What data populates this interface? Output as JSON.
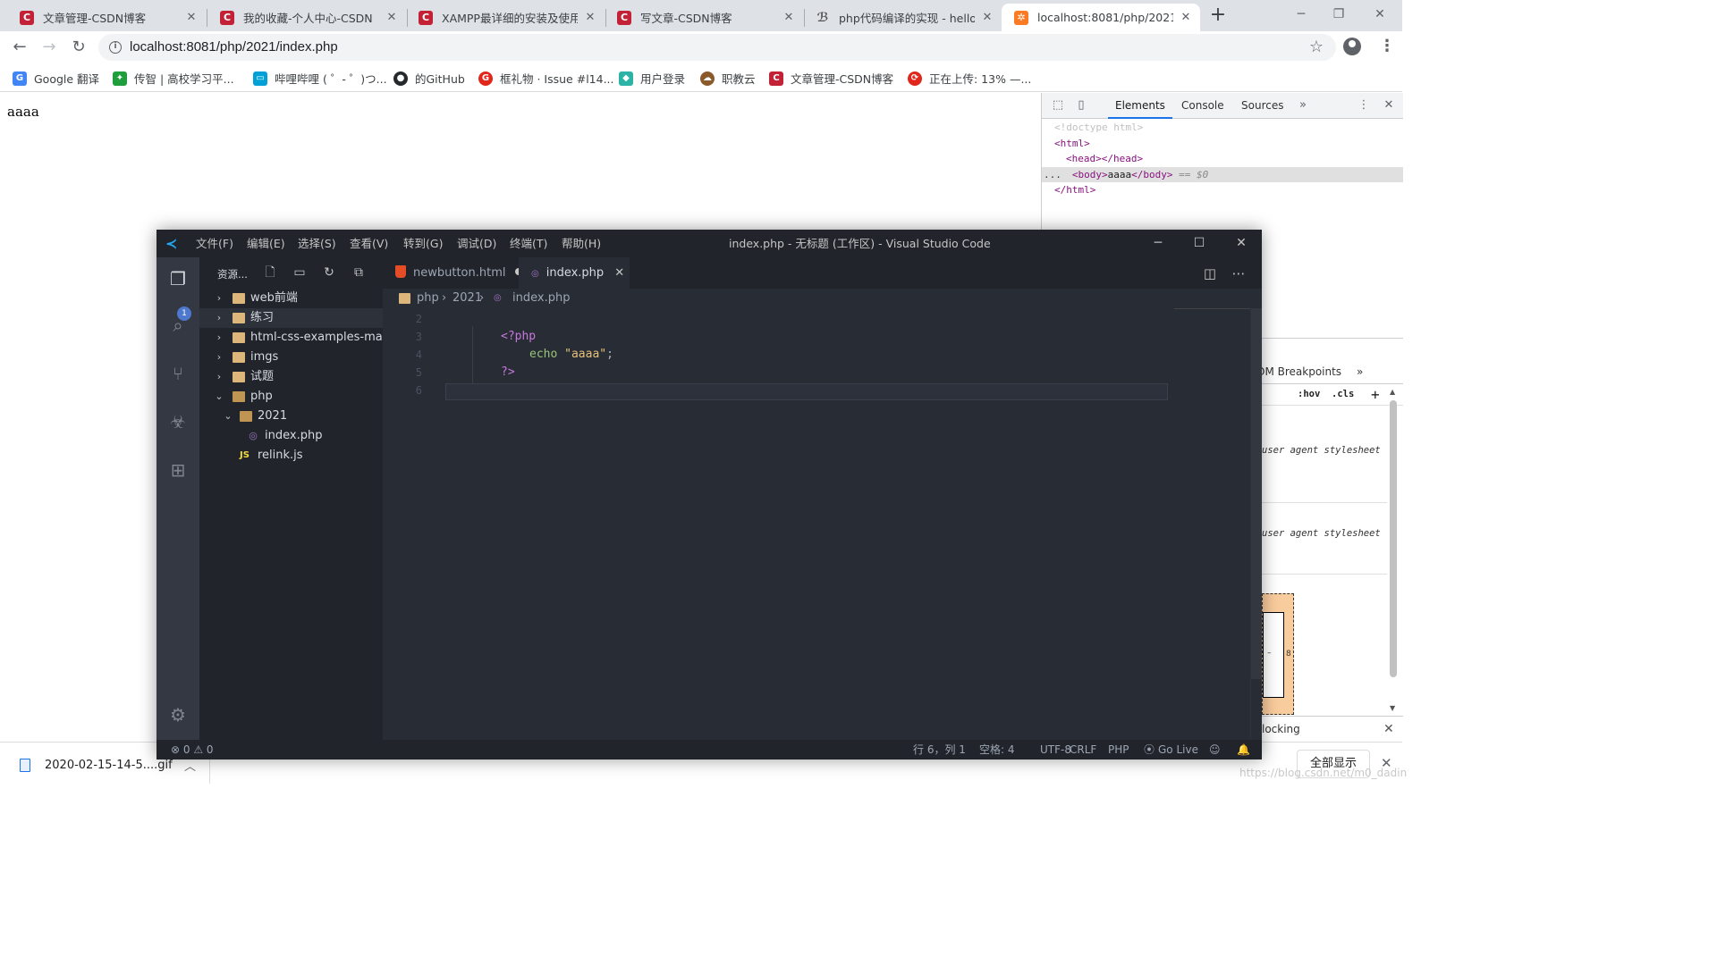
{
  "browser": {
    "tabs": [
      {
        "title": "文章管理-CSDN博客",
        "favicon_color": "#c32136"
      },
      {
        "title": "我的收藏-个人中心-CSDN",
        "favicon_color": "#c32136"
      },
      {
        "title": "XAMPP最详细的安装及使用",
        "favicon_color": "#c32136"
      },
      {
        "title": "写文章-CSDN博客",
        "favicon_color": "#c32136"
      },
      {
        "title": "php代码编译的实现 - hello",
        "favicon_color": "#555555"
      },
      {
        "title": "localhost:8081/php/2021/i",
        "favicon_color": "#fb7a24"
      }
    ],
    "new_tab_label": "+",
    "url": "localhost:8081/php/2021/index.php",
    "bookmarks": [
      {
        "label": "Google 翻译",
        "color": "#4285f4"
      },
      {
        "label": "传智 | 高校学习平...",
        "color": "#1e9e3c"
      },
      {
        "label": "哔哩哔哩 ( ゜- ゜)つ...",
        "color": "#00a1d6"
      },
      {
        "label": "的GitHub",
        "color": "#24292e"
      },
      {
        "label": "框礼物 · Issue #l14...",
        "color": "#e1261c"
      },
      {
        "label": "用户登录",
        "color": "#2bb3a5"
      },
      {
        "label": "职教云",
        "color": "#8b5a2b"
      },
      {
        "label": "文章管理-CSDN博客",
        "color": "#c32136"
      },
      {
        "label": "正在上传: 13% —...",
        "color": "#e1261c"
      }
    ]
  },
  "page": {
    "body_text": "aaaa"
  },
  "devtools": {
    "tabs": [
      "Elements",
      "Console",
      "Sources"
    ],
    "dom": {
      "doctype": "<!doctype html>",
      "html_open": "<html>",
      "head": "<head></head>",
      "body_open": "<body>",
      "body_text": "aaaa",
      "body_close": "</body>",
      "dollar": "== $0",
      "html_close": "</html>",
      "ellipsis": "..."
    },
    "lower_tab": "OM Breakpoints",
    "filter": {
      "hov": ":hov",
      "cls": ".cls"
    },
    "ua_label_1": "user agent stylesheet",
    "ua_label_2": "user agent stylesheet",
    "box_value": "8",
    "box_dash": "–",
    "blocking_label": "locking"
  },
  "downloads": {
    "file_name": "2020-02-15-14-5....gif",
    "show_all": "全部显示"
  },
  "watermark": "https://blog.csdn.net/m0_dadin",
  "vscode": {
    "menu": [
      "文件(F)",
      "编辑(E)",
      "选择(S)",
      "查看(V)",
      "转到(G)",
      "调试(D)",
      "终端(T)",
      "帮助(H)"
    ],
    "window_title": "index.php - 无标题 (工作区) - Visual Studio Code",
    "explorer_title": "资源...",
    "explorer_badge": "1",
    "tree": [
      {
        "label": "web前端",
        "depth": 0,
        "type": "folder",
        "open": false
      },
      {
        "label": "练习",
        "depth": 0,
        "type": "folder",
        "open": false
      },
      {
        "label": "html-css-examples-ma...",
        "depth": 0,
        "type": "folder",
        "open": false
      },
      {
        "label": "imgs",
        "depth": 0,
        "type": "folder",
        "open": false
      },
      {
        "label": "试题",
        "depth": 0,
        "type": "folder",
        "open": false
      },
      {
        "label": "php",
        "depth": 0,
        "type": "folder",
        "open": true
      },
      {
        "label": "2021",
        "depth": 1,
        "type": "folder",
        "open": true
      },
      {
        "label": "index.php",
        "depth": 2,
        "type": "php"
      },
      {
        "label": "relink.js",
        "depth": 1,
        "type": "js"
      }
    ],
    "js_badge": "JS",
    "editor_tabs": [
      {
        "label": "newbutton.html",
        "dirty": true
      },
      {
        "label": "index.php",
        "active": true
      }
    ],
    "breadcrumb": [
      "php",
      "2021",
      "index.php"
    ],
    "line_numbers": [
      "2",
      "3",
      "4",
      "5",
      "6"
    ],
    "code": {
      "open_tag": "<?php",
      "echo_kw": "echo",
      "string": "\"aaaa\"",
      "semicolon": ";",
      "close_tag": "?>"
    },
    "status": {
      "errors": "⊗ 0 ⚠ 0",
      "position": "行 6，列 1",
      "spaces": "空格: 4",
      "encoding": "UTF-8",
      "eol": "CRLF",
      "language": "PHP",
      "golive": "Go Live"
    }
  }
}
